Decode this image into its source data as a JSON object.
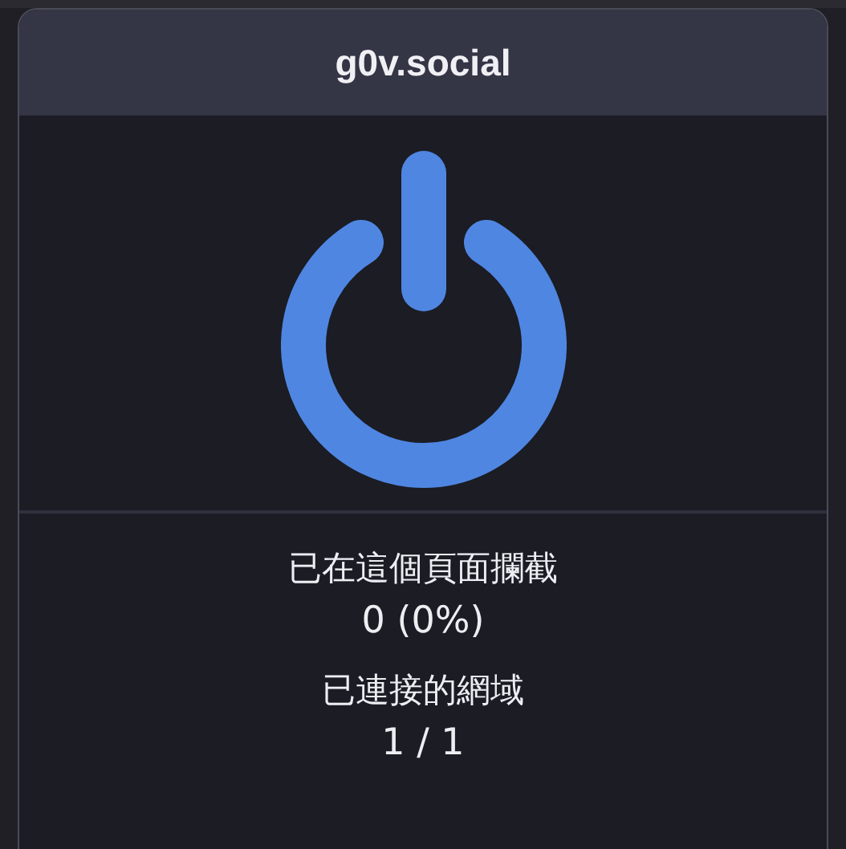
{
  "popup": {
    "hostname": "g0v.social"
  },
  "power_switch": {
    "on": true
  },
  "stats": [
    {
      "label": "已在這個頁面攔截",
      "value": "0 (0%)"
    },
    {
      "label": "已連接的網域",
      "value": "1 / 1"
    }
  ]
}
